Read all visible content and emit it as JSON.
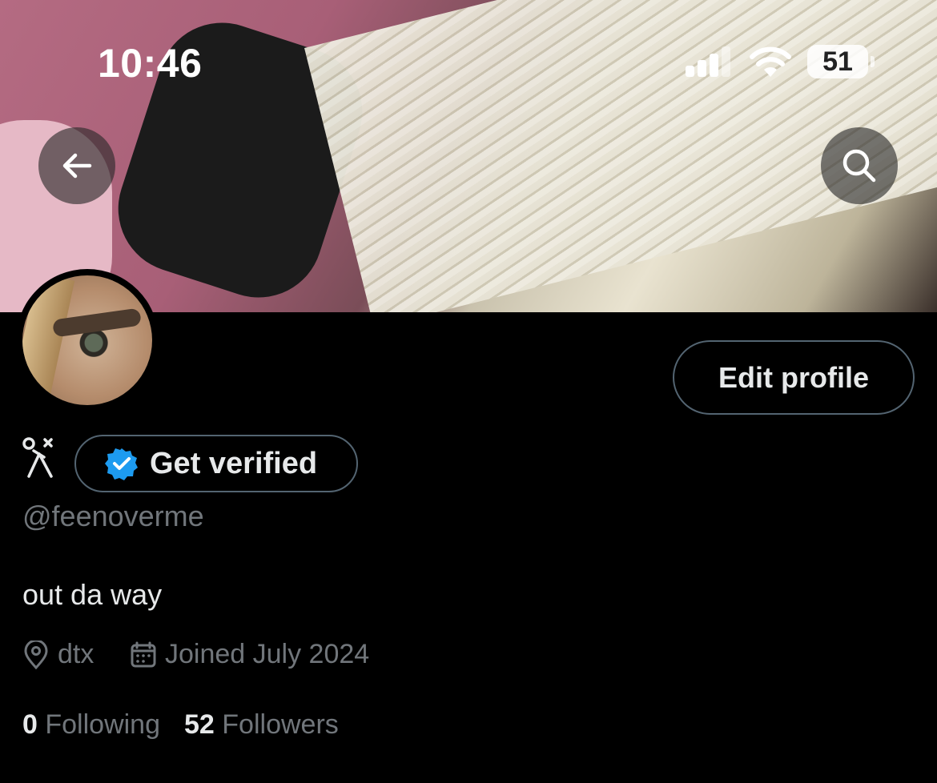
{
  "status_bar": {
    "time": "10:46",
    "battery": "51"
  },
  "header": {
    "back_icon": "arrow-left-icon",
    "search_icon": "search-icon"
  },
  "profile": {
    "edit_label": "Edit profile",
    "verified_label": "Get verified",
    "handle": "@feenoverme",
    "bio": "out da way",
    "location": "dtx",
    "joined": "Joined July 2024",
    "following_count": "0",
    "following_label": "Following",
    "followers_count": "52",
    "followers_label": "Followers"
  },
  "colors": {
    "background": "#000000",
    "text": "#e7e9ea",
    "muted": "#71767b",
    "border": "#536471",
    "verified_blue": "#1d9bf0"
  }
}
